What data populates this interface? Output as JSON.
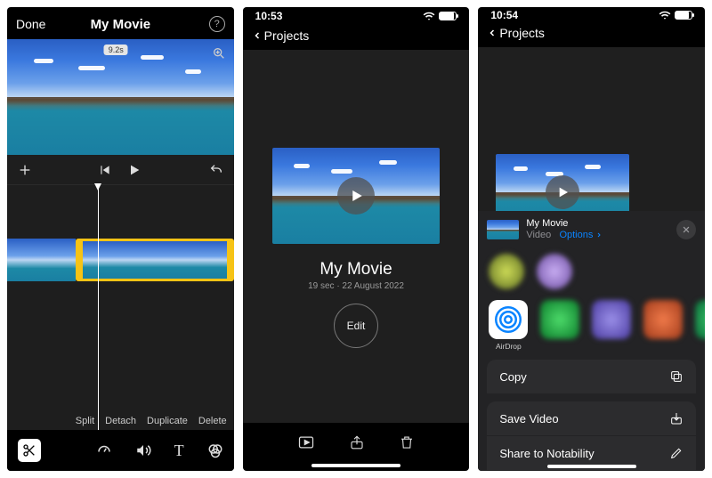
{
  "screen1": {
    "nav": {
      "done": "Done",
      "title": "My Movie"
    },
    "preview": {
      "duration_badge": "9.2s"
    },
    "clip_actions": [
      "Split",
      "Detach",
      "Duplicate",
      "Delete"
    ]
  },
  "screen2": {
    "status_time": "10:53",
    "back": "Projects",
    "title": "My Movie",
    "meta": "19 sec · 22 August 2022",
    "edit": "Edit"
  },
  "screen3": {
    "status_time": "10:54",
    "back": "Projects",
    "sheet": {
      "title": "My Movie",
      "subtitle_type": "Video",
      "options": "Options",
      "apps": {
        "airdrop": "AirDrop"
      },
      "actions": {
        "copy": "Copy",
        "save_video": "Save Video",
        "share_notability": "Share to Notability"
      }
    }
  }
}
